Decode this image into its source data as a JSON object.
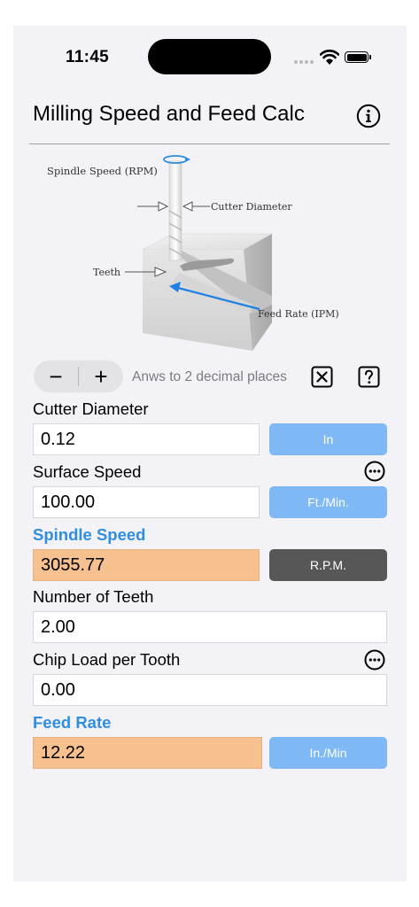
{
  "status_bar": {
    "time": "11:45"
  },
  "header": {
    "title": "Milling Speed and Feed Calc"
  },
  "diagram": {
    "labels": {
      "spindle_speed": "Spindle Speed (RPM)",
      "cutter_diameter": "Cutter Diameter",
      "teeth": "Teeth",
      "feed_rate": "Feed Rate (IPM)"
    }
  },
  "toolbar": {
    "minus": "−",
    "plus": "+",
    "decimals_note": "Anws to 2 decimal places"
  },
  "form": {
    "cutter_diameter": {
      "label": "Cutter Diameter",
      "value": "0.12",
      "unit": "In"
    },
    "surface_speed": {
      "label": "Surface Speed",
      "value": "100.00",
      "unit": "Ft./Min."
    },
    "spindle_speed": {
      "label": "Spindle Speed",
      "value": "3055.77",
      "unit": "R.P.M."
    },
    "number_of_teeth": {
      "label": "Number of Teeth",
      "value": "2.00"
    },
    "chip_load": {
      "label": "Chip Load per Tooth",
      "value": "0.00"
    },
    "feed_rate": {
      "label": "Feed Rate",
      "value": "12.22",
      "unit": "In./Min"
    }
  },
  "colors": {
    "accent": "#2f8ee0",
    "unit_button": "#7eb8f5",
    "unit_button_active": "#575757",
    "result_field": "#f7c08f",
    "background": "#f2f2f7"
  },
  "icons": {
    "info": "info-circle-icon",
    "clear": "clear-x-icon",
    "help": "question-icon",
    "more": "ellipsis-circle-icon",
    "wifi": "wifi-icon",
    "battery": "battery-icon"
  }
}
